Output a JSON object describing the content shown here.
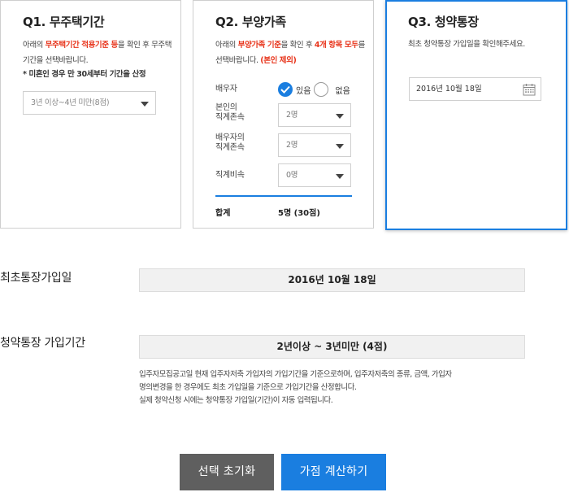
{
  "q1": {
    "title": "Q1. 무주택기간",
    "desc_pre": "아래의 ",
    "desc_red": "무주택기간 적용기준 등",
    "desc_post": "을 확인 후 무주택기간을 선택바랍니다.",
    "note": "* 미혼인 경우 만 30세부터 기간을 산정",
    "select_value": "3년 이상~4년 미만(8점)"
  },
  "q2": {
    "title": "Q2. 부양가족",
    "desc_pre": "아래의 ",
    "desc_red1": "부양가족 기준",
    "desc_mid": "을 확인 후 ",
    "desc_red2": "4개 항목 모두",
    "desc_post": "를 선택바랍니다. ",
    "desc_red3": "(본인 제외)",
    "spouse_label": "배우자",
    "spouse_yes": "있음",
    "spouse_no": "없음",
    "lineal_self_label_1": "본인의",
    "lineal_self_label_2": "직계존속",
    "lineal_self_value": "2명",
    "lineal_spouse_label_1": "배우자의",
    "lineal_spouse_label_2": "직계존속",
    "lineal_spouse_value": "2명",
    "descendant_label": "직계비속",
    "descendant_value": "0명",
    "total_label": "합계",
    "total_value": "5명 (30점)"
  },
  "q3": {
    "title": "Q3. 청약통장",
    "desc": "최초 청약통장 가입일을 확인해주세요.",
    "date_value": "2016년 10월 18일"
  },
  "summary": {
    "first_join_label": "최초통장가입일",
    "first_join_value": "2016년 10월 18일",
    "period_label": "청약통장 가입기간",
    "period_value": "2년이상 ~ 3년미만 (4점)",
    "explain_1": "입주자모집공고일 현재 입주자저축 가입자의 가입기간을 기준으로하며, 입주자저축의 종류, 금액, 가입자",
    "explain_2": "명의변경을 한 경우에도 최초 가입일을 기준으로 가입기간을 산정합니다.",
    "explain_3": "실제 청약신청 시에는 청약통장 가입일(기간)이 자동 입력됩니다."
  },
  "buttons": {
    "reset": "선택 초기화",
    "calculate": "가점 계산하기"
  },
  "colors": {
    "accent": "#1a7ee0",
    "highlight": "#e8351c",
    "reset_bg": "#5f5f5f"
  }
}
